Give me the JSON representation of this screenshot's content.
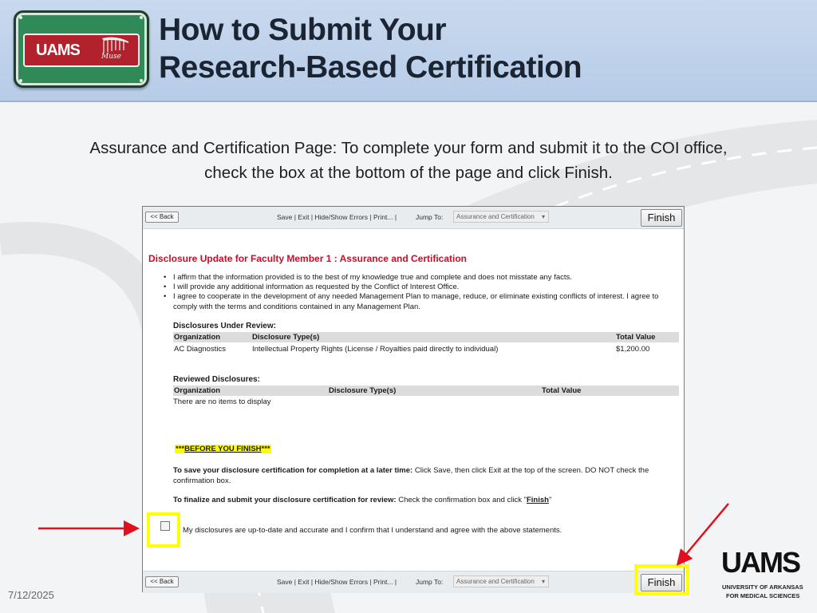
{
  "slide": {
    "title_line1": "How to Submit Your",
    "title_line2": "Research-Based Certification",
    "instruction_line1": "Assurance and Certification Page: To complete your form and submit it to the COI office,",
    "instruction_line2": "check the box at the bottom of the page and click Finish.",
    "date": "7/12/2025"
  },
  "logo_sign": {
    "plate_text": "UAMS",
    "plate_sub": "Muse",
    "colors": {
      "frame": "#2f8a57",
      "plate": "#b1222c"
    }
  },
  "toolbar": {
    "back_label": "<< Back",
    "links": "Save | Exit | Hide/Show Errors | Print... |",
    "jump_label": "Jump To:",
    "jump_selected": "Assurance and Certification",
    "finish_label": "Finish"
  },
  "form": {
    "heading": "Disclosure Update  for Faculty Member 1 : Assurance and Certification",
    "bullets": [
      "I affirm that the information provided is to the best of my knowledge true and complete and does not misstate any facts.",
      "I will provide any additional information as requested by the Conflict of Interest Office.",
      "I agree to cooperate in the development of any needed Management Plan to manage, reduce, or eliminate existing conflicts of interest. I agree to comply with the terms and conditions contained in any Management Plan."
    ],
    "under_review": {
      "label": "Disclosures Under Review:",
      "headers": [
        "Organization",
        "Disclosure Type(s)",
        "Total Value"
      ],
      "rows": [
        [
          "AC Diagnostics",
          "Intellectual Property Rights (License / Royalties paid directly to individual)",
          "$1,200.00"
        ]
      ]
    },
    "reviewed": {
      "label": "Reviewed Disclosures:",
      "headers": [
        "Organization",
        "Disclosure Type(s)",
        "Total Value"
      ],
      "empty_text": "There are no items to display"
    },
    "before_finish": {
      "stars_left": "***",
      "text": "BEFORE YOU FINISH",
      "stars_right": "***"
    },
    "save_para": {
      "bold": "To save your disclosure certification for completion at a later time:",
      "rest": " Click Save, then click Exit at the top of the screen.  DO NOT check the confirmation box."
    },
    "finalize_para": {
      "bold": "To finalize and submit your disclosure certification for review:",
      "rest": "  Check the confirmation box and click \"",
      "link": "Finish",
      "end": "\""
    },
    "confirm_text": "My disclosures are up-to-date and accurate and I confirm that I understand and agree with the above statements."
  },
  "uams_logo": {
    "word": "UAMS",
    "line1": "UNIVERSITY OF ARKANSAS",
    "line2": "FOR MEDICAL SCIENCES"
  },
  "colors": {
    "highlight": "#ffff00",
    "arrow": "#e0101e",
    "heading_red": "#c0102a"
  }
}
